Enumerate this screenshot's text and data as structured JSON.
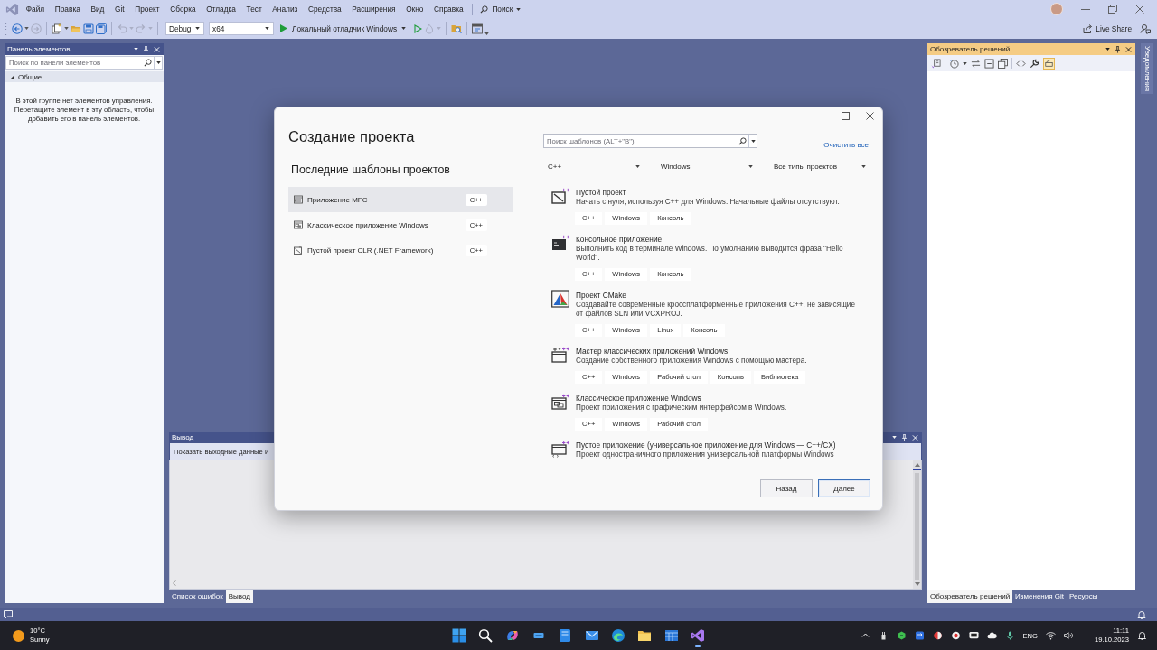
{
  "title_bar": {
    "menu": [
      "Файл",
      "Правка",
      "Вид",
      "Git",
      "Проект",
      "Сборка",
      "Отладка",
      "Тест",
      "Анализ",
      "Средства",
      "Расширения",
      "Окно",
      "Справка"
    ],
    "search": "Поиск"
  },
  "toolbar": {
    "configuration": "Debug",
    "platform": "x64",
    "run_target": "Локальный отладчик Windows",
    "live_share": "Live Share"
  },
  "toolbox": {
    "title": "Панель элементов",
    "active": false,
    "search": {
      "placeholder": "Поиск по панели элементов"
    },
    "groups": [
      {
        "name": "Общие",
        "expanded": true,
        "empty_message": "В этой группе нет элементов управления. Перетащите элемент в эту область, чтобы добавить его в панель элементов."
      }
    ]
  },
  "output": {
    "title": "Вывод",
    "active": false,
    "show_output_from": "Показать выходные данные и",
    "tabs": [
      {
        "label": "Список ошибок",
        "selected": false
      },
      {
        "label": "Вывод",
        "selected": true
      }
    ]
  },
  "solution_explorer": {
    "title": "Обозреватель решений",
    "active": true,
    "tabs": [
      {
        "label": "Обозреватель решений",
        "selected": true
      },
      {
        "label": "Изменения Git",
        "selected": false
      },
      {
        "label": "Ресурсы",
        "selected": false
      }
    ]
  },
  "notifications_tab": "Уведомления",
  "dialog": {
    "title": "Создание проекта",
    "recent_heading": "Последние шаблоны проектов",
    "recent_templates": [
      {
        "kind": "mfc",
        "name": "Приложение MFC",
        "language": "C++",
        "selected": true
      },
      {
        "kind": "desktop",
        "name": "Классическое приложение Windows",
        "language": "C++",
        "selected": false
      },
      {
        "kind": "clr",
        "name": "Пустой проект CLR (.NET Framework)",
        "language": "C++",
        "selected": false
      }
    ],
    "search": {
      "placeholder": "Поиск шаблонов (ALT+\"В\")"
    },
    "clear_all": "Очистить все",
    "filters": [
      "C++",
      "Windows",
      "Все типы проектов"
    ],
    "templates": [
      {
        "kind": "empty",
        "name": "Пустой проект",
        "description": "Начать с нуля, используя C++ для Windows. Начальные файлы отсутствуют.",
        "tags": [
          "C++",
          "Windows",
          "Консоль"
        ]
      },
      {
        "kind": "console",
        "name": "Консольное приложение",
        "description": "Выполнить код в терминале Windows. По умолчанию выводится фраза \"Hello World\".",
        "tags": [
          "C++",
          "Windows",
          "Консоль"
        ]
      },
      {
        "kind": "cmake",
        "name": "Проект CMake",
        "description": "Создавайте современные кроссплатформенные приложения C++, не зависящие от файлов SLN или VCXPROJ.",
        "tags": [
          "C++",
          "Windows",
          "Linux",
          "Консоль"
        ]
      },
      {
        "kind": "wizard",
        "name": "Мастер классических приложений Windows",
        "description": "Создание собственного приложения Windows с помощью мастера.",
        "tags": [
          "C++",
          "Windows",
          "Рабочий стол",
          "Консоль",
          "Библиотека"
        ]
      },
      {
        "kind": "desktop",
        "name": "Классическое приложение Windows",
        "description": "Проект приложения с графическим интерфейсом в Windows.",
        "tags": [
          "C++",
          "Windows",
          "Рабочий стол"
        ]
      },
      {
        "kind": "uwp",
        "name": "Пустое приложение (универсальное приложение для Windows — C++/CX)",
        "description": "Проект одностраничного приложения универсальной платформы Windows"
      }
    ],
    "buttons": [
      {
        "label": "Назад",
        "default": false
      },
      {
        "label": "Далее",
        "default": true
      }
    ]
  },
  "taskbar": {
    "weather": {
      "temperature": "10°C",
      "condition": "Sunny"
    },
    "apps": [
      {
        "kind": "start",
        "active": false
      },
      {
        "kind": "search",
        "active": false
      },
      {
        "kind": "swirl",
        "active": false
      },
      {
        "kind": "chip",
        "active": false
      },
      {
        "kind": "tile",
        "active": false
      },
      {
        "kind": "mail",
        "active": false
      },
      {
        "kind": "wave",
        "active": false
      },
      {
        "kind": "folder",
        "active": false
      },
      {
        "kind": "grid",
        "active": false
      },
      {
        "kind": "ribbon",
        "active": true
      }
    ],
    "language": "ENG",
    "time": "11:11",
    "date": "19.10.2023"
  }
}
